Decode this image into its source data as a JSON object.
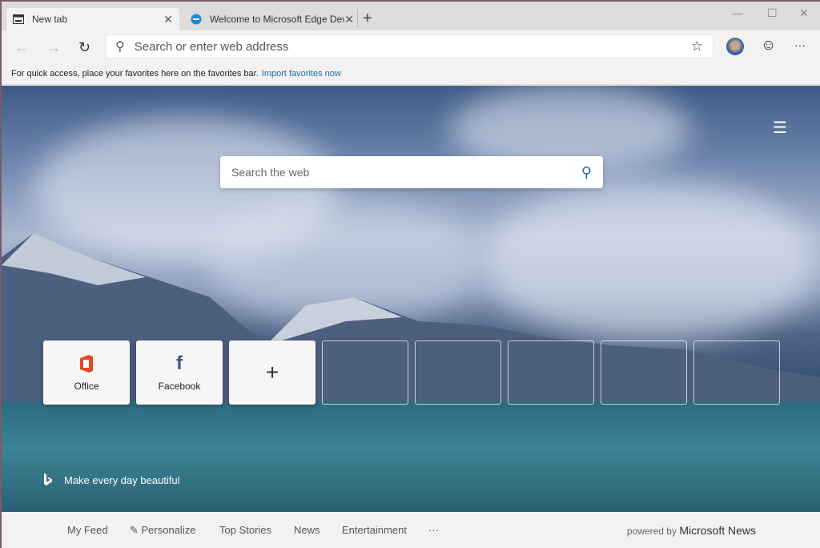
{
  "tabs": [
    {
      "label": "New tab",
      "icon": "new-tab-icon",
      "active": true
    },
    {
      "label": "Welcome to Microsoft Edge Dev",
      "icon": "edge-icon",
      "active": false
    }
  ],
  "address": {
    "placeholder": "Search or enter web address"
  },
  "favorites_bar": {
    "message": "For quick access, place your favorites here on the favorites bar.",
    "link": "Import favorites now"
  },
  "search": {
    "placeholder": "Search the web"
  },
  "quick_links": [
    {
      "label": "Office",
      "icon": "office-icon"
    },
    {
      "label": "Facebook",
      "icon": "facebook-icon"
    },
    {
      "label": "+",
      "icon": "plus-icon"
    }
  ],
  "bing": {
    "tagline": "Make every day beautiful"
  },
  "news_bar": {
    "items": [
      "My Feed",
      "Personalize",
      "Top Stories",
      "News",
      "Entertainment",
      "···"
    ],
    "powered_by": "powered by",
    "brand": "Microsoft News"
  },
  "colors": {
    "link": "#1a6bb5",
    "office": "#e3491e",
    "facebook": "#3b5998"
  }
}
